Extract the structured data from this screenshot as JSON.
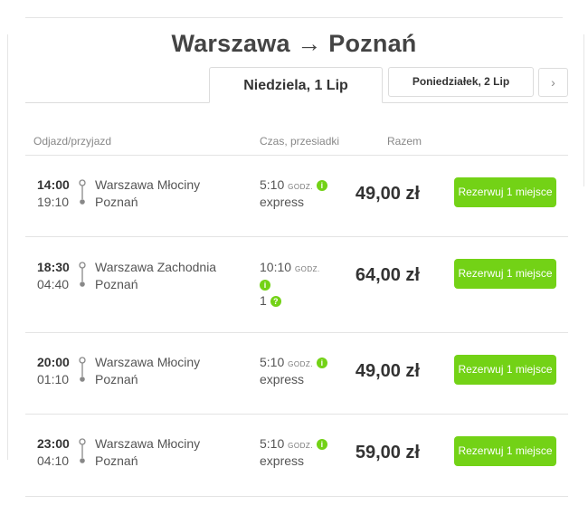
{
  "header": {
    "title": "Warszawa → Poznań"
  },
  "tabs": {
    "active": "Niedziela, 1 Lip",
    "next_day": "Poniedziałek, 2 Lip",
    "next_arrow": "›"
  },
  "columns": {
    "departure": "Odjazd/przyjazd",
    "duration": "Czas, przesiadki",
    "total": "Razem"
  },
  "colors": {
    "accent": "#73d216"
  },
  "trips": [
    {
      "dep_time": "14:00",
      "arr_time": "19:10",
      "from": "Warszawa Młociny",
      "to": "Poznań",
      "duration": "5:10",
      "unit": "GODZ.",
      "info": "i",
      "line2": "express",
      "price": "49,00 zł",
      "button": "Rezerwuj 1 miejsce"
    },
    {
      "dep_time": "18:30",
      "arr_time": "04:40",
      "from": "Warszawa Zachodnia",
      "to": "Poznań",
      "duration": "10:10",
      "unit": "GODZ.",
      "info": "i",
      "transfers": "1",
      "transfers_icon": "?",
      "price": "64,00 zł",
      "button": "Rezerwuj 1 miejsce"
    },
    {
      "dep_time": "20:00",
      "arr_time": "01:10",
      "from": "Warszawa Młociny",
      "to": "Poznań",
      "duration": "5:10",
      "unit": "GODZ.",
      "info": "i",
      "line2": "express",
      "price": "49,00 zł",
      "button": "Rezerwuj 1 miejsce"
    },
    {
      "dep_time": "23:00",
      "arr_time": "04:10",
      "from": "Warszawa Młociny",
      "to": "Poznań",
      "duration": "5:10",
      "unit": "GODZ.",
      "info": "i",
      "line2": "express",
      "price": "59,00 zł",
      "button": "Rezerwuj 1 miejsce"
    }
  ]
}
